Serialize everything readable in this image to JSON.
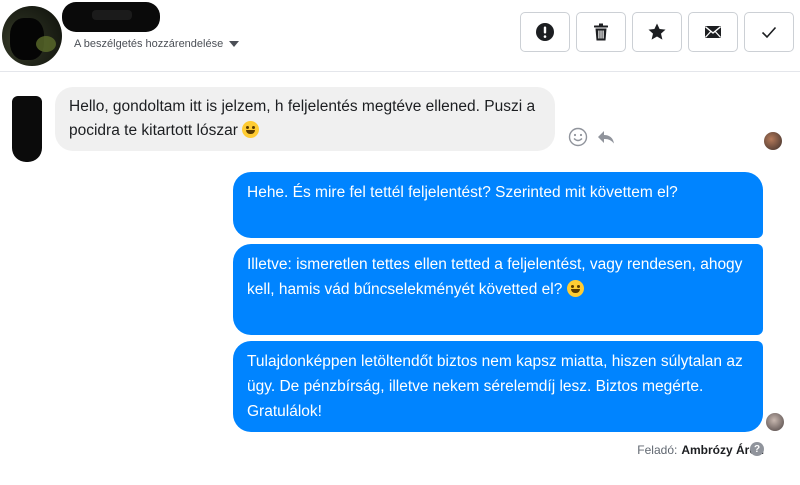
{
  "header": {
    "assign_label": "A beszélgetés hozzárendelése",
    "toolbar": [
      {
        "icon": "exclamation-icon",
        "action": "mark-spam"
      },
      {
        "icon": "trash-icon",
        "action": "delete"
      },
      {
        "icon": "star-icon",
        "action": "star"
      },
      {
        "icon": "envelope-icon",
        "action": "mark-unread"
      },
      {
        "icon": "checkmark-icon",
        "action": "mark-done"
      }
    ]
  },
  "messages": {
    "incoming_1": "Hello, gondoltam itt is jelzem, h feljelentés megtéve ellened. Puszi a pocidra te kitartott lószar",
    "outgoing_1": "Hehe. És mire fel tettél feljelentést? Szerinted mit követtem el?",
    "outgoing_2": "Illetve: ismeretlen tettes ellen tetted a feljelentést, vagy rendesen, ahogy kell, hamis vád bűncselekményét követted el?",
    "outgoing_3": "Tulajdonképpen letöltendőt biztos nem kapsz miatta, hiszen súlytalan az ügy. De pénzbírság, illetve nekem sérelemdíj lesz. Biztos megérte. Gratulálok!"
  },
  "footer": {
    "sender_label": "Feladó:",
    "sender_name": "Ambrózy Áron",
    "help_glyph": "?"
  },
  "colors": {
    "outgoing_bubble": "#0084ff",
    "incoming_bubble": "#f0f0f0"
  }
}
